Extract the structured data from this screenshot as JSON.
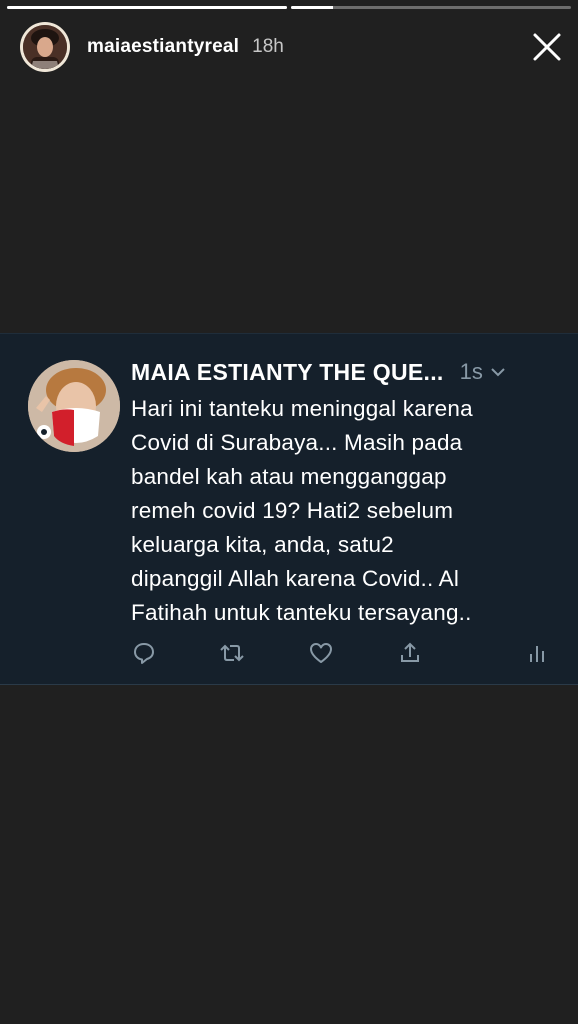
{
  "story": {
    "progress": [
      1,
      0.15
    ],
    "username": "maiaestiantyreal",
    "time": "18h"
  },
  "tweet": {
    "display_name": "MAIA ESTIANTY THE QUE...",
    "age": "1s",
    "lines": [
      "Hari ini tanteku meninggal karena",
      "Covid di Surabaya... Masih pada",
      "bandel kah atau mengganggap",
      "remeh covid 19? Hati2  sebelum",
      "keluarga kita, anda,  satu2",
      "dipanggil Allah karena Covid.. Al",
      "Fatihah untuk tanteku tersayang.."
    ],
    "actions": [
      "reply-icon",
      "retweet-icon",
      "like-icon",
      "share-icon",
      "analytics-icon"
    ]
  },
  "colors": {
    "background": "#202020",
    "tweet_bg": "#15202b",
    "muted_text": "#8899a6"
  }
}
